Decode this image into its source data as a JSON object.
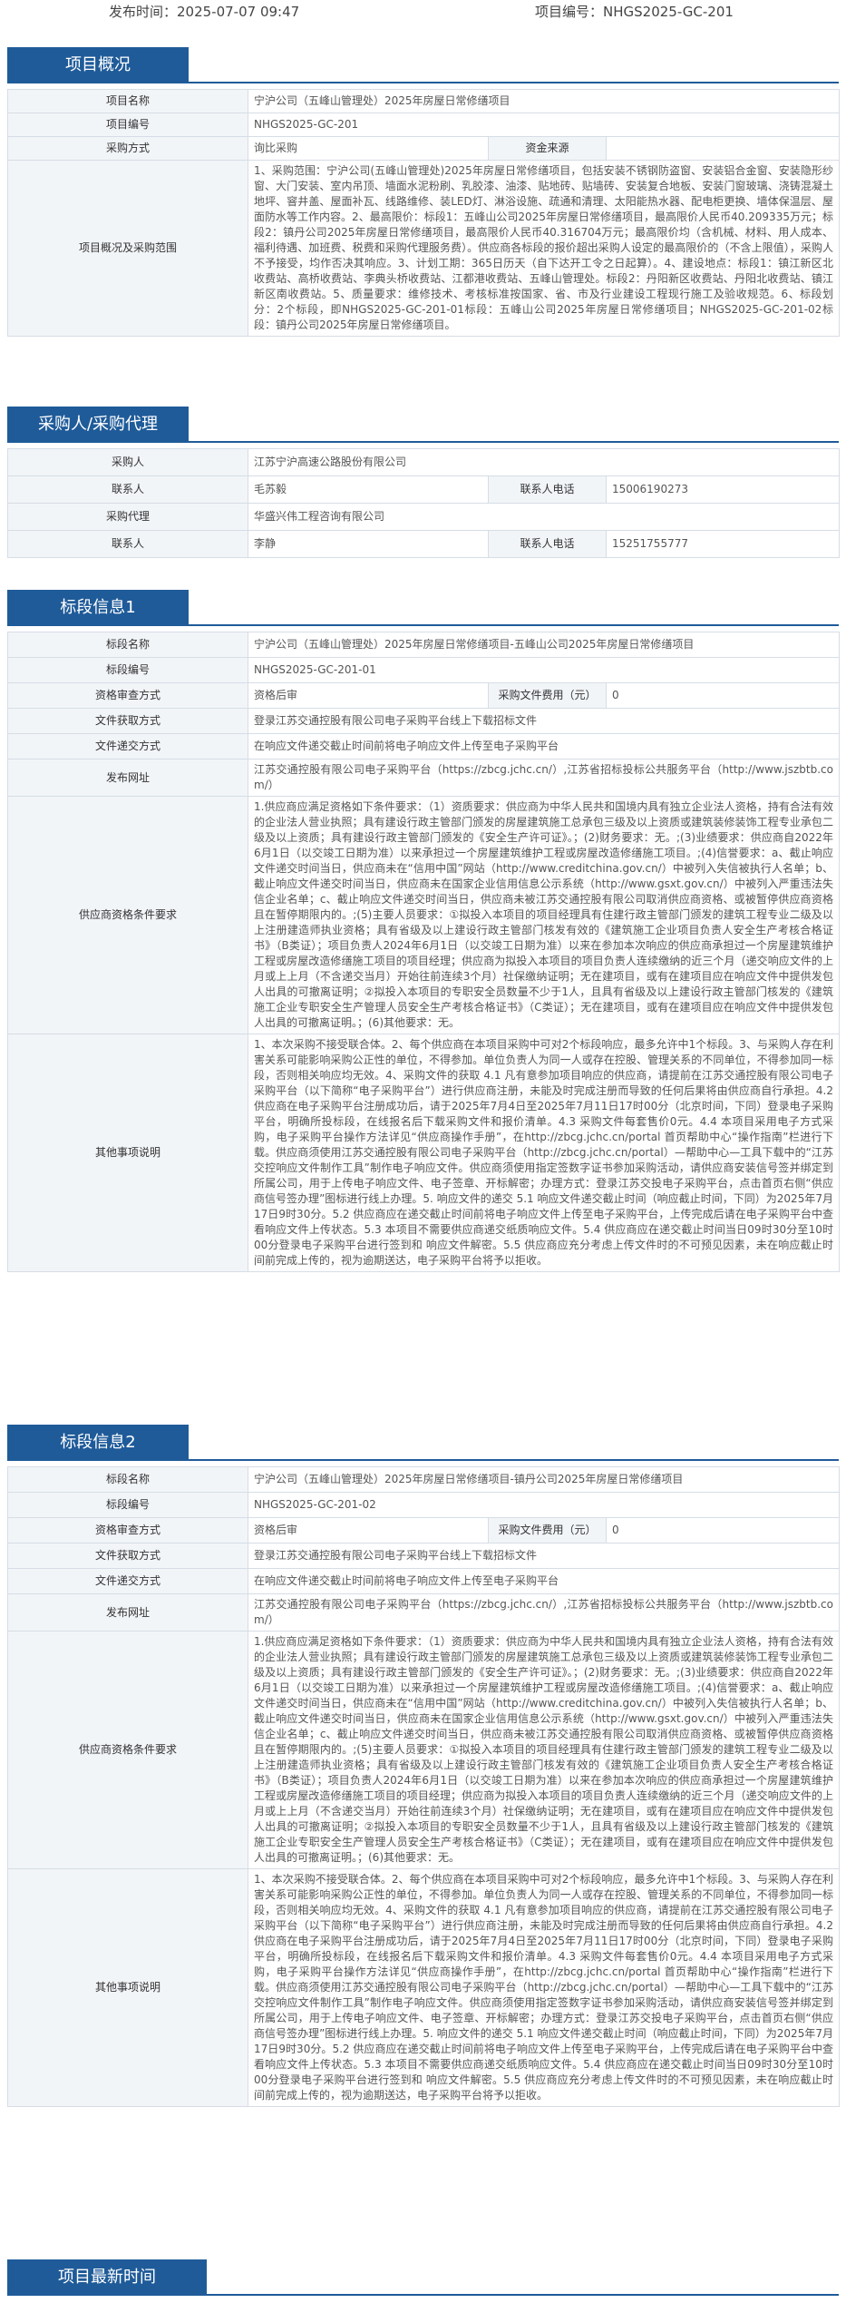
{
  "header": {
    "publish_time": "发布时间：2025-07-07 09:47",
    "project_no": "项目编号：NHGS2025-GC-201"
  },
  "overview": {
    "title": "项目概况",
    "name_label": "项目名称",
    "name_value": "宁沪公司（五峰山管理处）2025年房屋日常修缮项目",
    "no_label": "项目编号",
    "no_value": "NHGS2025-GC-201",
    "method_label": "采购方式",
    "method_value": "询比采购",
    "fund_label": "资金来源",
    "fund_value": "",
    "scope_label": "项目概况及采购范围",
    "scope_value": "1、采购范围：宁沪公司(五峰山管理处)2025年房屋日常修缮项目，包括安装不锈钢防盗窗、安装铝合金窗、安装隐形纱窗、大门安装、室内吊顶、墙面水泥粉刷、乳胶漆、油漆、贴地砖、贴墙砖、安装复合地板、安装门窗玻璃、浇铸混凝土地坪、窨井盖、屋面补瓦、线路维修、装LED灯、淋浴设施、疏通和清理、太阳能热水器、配电柜更换、墙体保温层、屋面防水等工作内容。2、最高限价：标段1：五峰山公司2025年房屋日常修缮项目，最高限价人民币40.209335万元；标段2：镇丹公司2025年房屋日常修缮项目，最高限价人民币40.316704万元；最高限价均（含机械、材料、用人成本、福利待遇、加班费、税费和采购代理服务费）。供应商各标段的报价超出采购人设定的最高限价的（不含上限值），采购人不予接受，均作否决其响应。3、计划工期：365日历天（自下达开工令之日起算）。4、建设地点：标段1：镇江新区北收费站、高桥收费站、李典头桥收费站、江都港收费站、五峰山管理处。标段2：丹阳新区收费站、丹阳北收费站、镇江新区南收费站。5、质量要求：维修技术、考核标准按国家、省、市及行业建设工程现行施工及验收规范。6、标段划分：2个标段，即NHGS2025-GC-201-01标段：五峰山公司2025年房屋日常修缮项目；NHGS2025-GC-201-02标段：镇丹公司2025年房屋日常修缮项目。"
  },
  "buyer": {
    "title": "采购人/采购代理",
    "buyer_label": "采购人",
    "buyer_value": "江苏宁沪高速公路股份有限公司",
    "contact_label": "联系人",
    "contact_value": "毛苏毅",
    "phone_label": "联系人电话",
    "phone_value": "15006190273",
    "agent_label": "采购代理",
    "agent_value": "华盛兴伟工程咨询有限公司",
    "agent_contact_label": "联系人",
    "agent_contact_value": "李静",
    "agent_phone_label": "联系人电话",
    "agent_phone_value": "15251755777"
  },
  "lot1": {
    "title": "标段信息1",
    "name_label": "标段名称",
    "name_value": "宁沪公司（五峰山管理处）2025年房屋日常修缮项目-五峰山公司2025年房屋日常修缮项目",
    "no_label": "标段编号",
    "no_value": "NHGS2025-GC-201-01",
    "review_label": "资格审查方式",
    "review_value": "资格后审",
    "fee_label": "采购文件费用（元）",
    "fee_value": "0",
    "get_label": "文件获取方式",
    "get_value": "登录江苏交通控股有限公司电子采购平台线上下载招标文件",
    "submit_label": "文件递交方式",
    "submit_value": "在响应文件递交截止时间前将电子响应文件上传至电子采购平台",
    "site_label": "发布网址",
    "site_value": "江苏交通控股有限公司电子采购平台（https://zbcg.jchc.cn/）,江苏省招标投标公共服务平台（http://www.jszbtb.com/）",
    "qual_label": "供应商资格条件要求",
    "qual_value": "1.供应商应满足资格如下条件要求：（1）资质要求：供应商为中华人民共和国境内具有独立企业法人资格，持有合法有效的企业法人营业执照；具有建设行政主管部门颁发的房屋建筑施工总承包三级及以上资质或建筑装修装饰工程专业承包二级及以上资质；具有建设行政主管部门颁发的《安全生产许可证》。；(2)财务要求：无。;(3)业绩要求：供应商自2022年6月1日（以交竣工日期为准）以来承担过一个房屋建筑维护工程或房屋改造修缮施工项目。;(4)信誉要求：a、截止响应文件递交时间当日，供应商未在“信用中国”网站（http://www.creditchina.gov.cn/）中被列入失信被执行人名单；b、截止响应文件递交时间当日，供应商未在国家企业信用信息公示系统（http://www.gsxt.gov.cn/）中被列入严重违法失信企业名单；c、截止响应文件递交时间当日，供应商未被江苏交通控股有限公司取消供应商资格、或被暂停供应商资格且在暂停期限内的。;(5)主要人员要求：①拟投入本项目的项目经理具有住建行政主管部门颁发的建筑工程专业二级及以上注册建造师执业资格；具有省级及以上建设行政主管部门核发有效的《建筑施工企业项目负责人安全生产考核合格证书》（B类证）；项目负责人2024年6月1日（以交竣工日期为准）以来在参加本次响应的供应商承担过一个房屋建筑维护工程或房屋改造修缮施工项目的项目经理；供应商为拟投入本项目的项目负责人连续缴纳的近三个月（递交响应文件的上月或上上月（不含递交当月）开始往前连续3个月）社保缴纳证明；无在建项目，或有在建项目应在响应文件中提供发包人出具的可撤离证明；②拟投入本项目的专职安全员数量不少于1人，且具有省级及以上建设行政主管部门核发的《建筑施工企业专职安全生产管理人员安全生产考核合格证书》（C类证）；无在建项目，或有在建项目应在响应文件中提供发包人出具的可撤离证明。；(6)其他要求：无。",
    "other_label": "其他事项说明",
    "other_value": "1、本次采购不接受联合体。2、每个供应商在本项目采购中可对2个标段响应，最多允许中1个标段。3、与采购人存在利害关系可能影响采购公正性的单位，不得参加。单位负责人为同一人或存在控股、管理关系的不同单位，不得参加同一标段，否则相关响应均无效。4、采购文件的获取 4.1 凡有意参加项目响应的供应商，请提前在江苏交通控股有限公司电子采购平台（以下简称“电子采购平台”）进行供应商注册，未能及时完成注册而导致的任何后果将由供应商自行承担。4.2 供应商在电子采购平台注册成功后，请于2025年7月4日至2025年7月11日17时00分（北京时间，下同）登录电子采购平台，明确所投标段，在线报名后下载采购文件和报价清单。4.3 采购文件每套售价0元。4.4 本项目采用电子方式采购，电子采购平台操作方法详见“供应商操作手册”，在http://zbcg.jchc.cn/portal 首页帮助中心“操作指南”栏进行下载。供应商须使用江苏交通控股有限公司电子采购平台（http://zbcg.jchc.cn/portal）—帮助中心—工具下载中的“江苏交控响应文件制作工具”制作电子响应文件。供应商须使用指定签数字证书参加采购活动，请供应商安装信号签并绑定到所属公司，用于上传电子响应文件、电子签章、开标解密；办理方式：登录江苏交投电子采购平台，点击首页右侧“供应商信号签办理”图标进行线上办理。5. 响应文件的递交 5.1 响应文件递交截止时间（响应截止时间，下同）为2025年7月17日9时30分。5.2 供应商应在递交截止时间前将电子响应文件上传至电子采购平台，上传完成后请在电子采购平台中查看响应文件上传状态。5.3 本项目不需要供应商递交纸质响应文件。5.4 供应商应在递交截止时间当日09时30分至10时00分登录电子采购平台进行签到和 响应文件解密。5.5 供应商应充分考虑上传文件时的不可预见因素，未在响应截止时间前完成上传的，视为逾期送达，电子采购平台将予以拒收。"
  },
  "lot2": {
    "title": "标段信息2",
    "name_label": "标段名称",
    "name_value": "宁沪公司（五峰山管理处）2025年房屋日常修缮项目-镇丹公司2025年房屋日常修缮项目",
    "no_label": "标段编号",
    "no_value": "NHGS2025-GC-201-02",
    "review_label": "资格审查方式",
    "review_value": "资格后审",
    "fee_label": "采购文件费用（元）",
    "fee_value": "0",
    "get_label": "文件获取方式",
    "get_value": "登录江苏交通控股有限公司电子采购平台线上下载招标文件",
    "submit_label": "文件递交方式",
    "submit_value": "在响应文件递交截止时间前将电子响应文件上传至电子采购平台",
    "site_label": "发布网址",
    "site_value": "江苏交通控股有限公司电子采购平台（https://zbcg.jchc.cn/）,江苏省招标投标公共服务平台（http://www.jszbtb.com/）",
    "qual_label": "供应商资格条件要求",
    "qual_value": "1.供应商应满足资格如下条件要求：（1）资质要求：供应商为中华人民共和国境内具有独立企业法人资格，持有合法有效的企业法人营业执照；具有建设行政主管部门颁发的房屋建筑施工总承包三级及以上资质或建筑装修装饰工程专业承包二级及以上资质；具有建设行政主管部门颁发的《安全生产许可证》。；(2)财务要求：无。;(3)业绩要求：供应商自2022年6月1日（以交竣工日期为准）以来承担过一个房屋建筑维护工程或房屋改造修缮施工项目。;(4)信誉要求：a、截止响应文件递交时间当日，供应商未在“信用中国”网站（http://www.creditchina.gov.cn/）中被列入失信被执行人名单；b、截止响应文件递交时间当日，供应商未在国家企业信用信息公示系统（http://www.gsxt.gov.cn/）中被列入严重违法失信企业名单；c、截止响应文件递交时间当日，供应商未被江苏交通控股有限公司取消供应商资格、或被暂停供应商资格且在暂停期限内的。;(5)主要人员要求：①拟投入本项目的项目经理具有住建行政主管部门颁发的建筑工程专业二级及以上注册建造师执业资格；具有省级及以上建设行政主管部门核发有效的《建筑施工企业项目负责人安全生产考核合格证书》（B类证）；项目负责人2024年6月1日（以交竣工日期为准）以来在参加本次响应的供应商承担过一个房屋建筑维护工程或房屋改造修缮施工项目的项目经理；供应商为拟投入本项目的项目负责人连续缴纳的近三个月（递交响应文件的上月或上上月（不含递交当月）开始往前连续3个月）社保缴纳证明；无在建项目，或有在建项目应在响应文件中提供发包人出具的可撤离证明；②拟投入本项目的专职安全员数量不少于1人，且具有省级及以上建设行政主管部门核发的《建筑施工企业专职安全生产管理人员安全生产考核合格证书》（C类证）；无在建项目，或有在建项目应在响应文件中提供发包人出具的可撤离证明。；(6)其他要求：无。",
    "other_label": "其他事项说明",
    "other_value": "1、本次采购不接受联合体。2、每个供应商在本项目采购中可对2个标段响应，最多允许中1个标段。3、与采购人存在利害关系可能影响采购公正性的单位，不得参加。单位负责人为同一人或存在控股、管理关系的不同单位，不得参加同一标段，否则相关响应均无效。4、采购文件的获取 4.1 凡有意参加项目响应的供应商，请提前在江苏交通控股有限公司电子采购平台（以下简称“电子采购平台”）进行供应商注册，未能及时完成注册而导致的任何后果将由供应商自行承担。4.2 供应商在电子采购平台注册成功后，请于2025年7月4日至2025年7月11日17时00分（北京时间，下同）登录电子采购平台，明确所投标段，在线报名后下载采购文件和报价清单。4.3 采购文件每套售价0元。4.4 本项目采用电子方式采购，电子采购平台操作方法详见“供应商操作手册”，在http://zbcg.jchc.cn/portal 首页帮助中心“操作指南”栏进行下载。供应商须使用江苏交通控股有限公司电子采购平台（http://zbcg.jchc.cn/portal）—帮助中心—工具下载中的“江苏交控响应文件制作工具”制作电子响应文件。供应商须使用指定签数字证书参加采购活动，请供应商安装信号签并绑定到所属公司，用于上传电子响应文件、电子签章、开标解密；办理方式：登录江苏交投电子采购平台，点击首页右侧“供应商信号签办理”图标进行线上办理。5. 响应文件的递交 5.1 响应文件递交截止时间（响应截止时间，下同）为2025年7月17日9时30分。5.2 供应商应在递交截止时间前将电子响应文件上传至电子采购平台，上传完成后请在电子采购平台中查看响应文件上传状态。5.3 本项目不需要供应商递交纸质响应文件。5.4 供应商应在递交截止时间当日09时30分至10时00分登录电子采购平台进行签到和 响应文件解密。5.5 供应商应充分考虑上传文件时的不可预见因素，未在响应截止时间前完成上传的，视为逾期送达，电子采购平台将予以拒收。"
  },
  "latest": {
    "title": "项目最新时间"
  }
}
